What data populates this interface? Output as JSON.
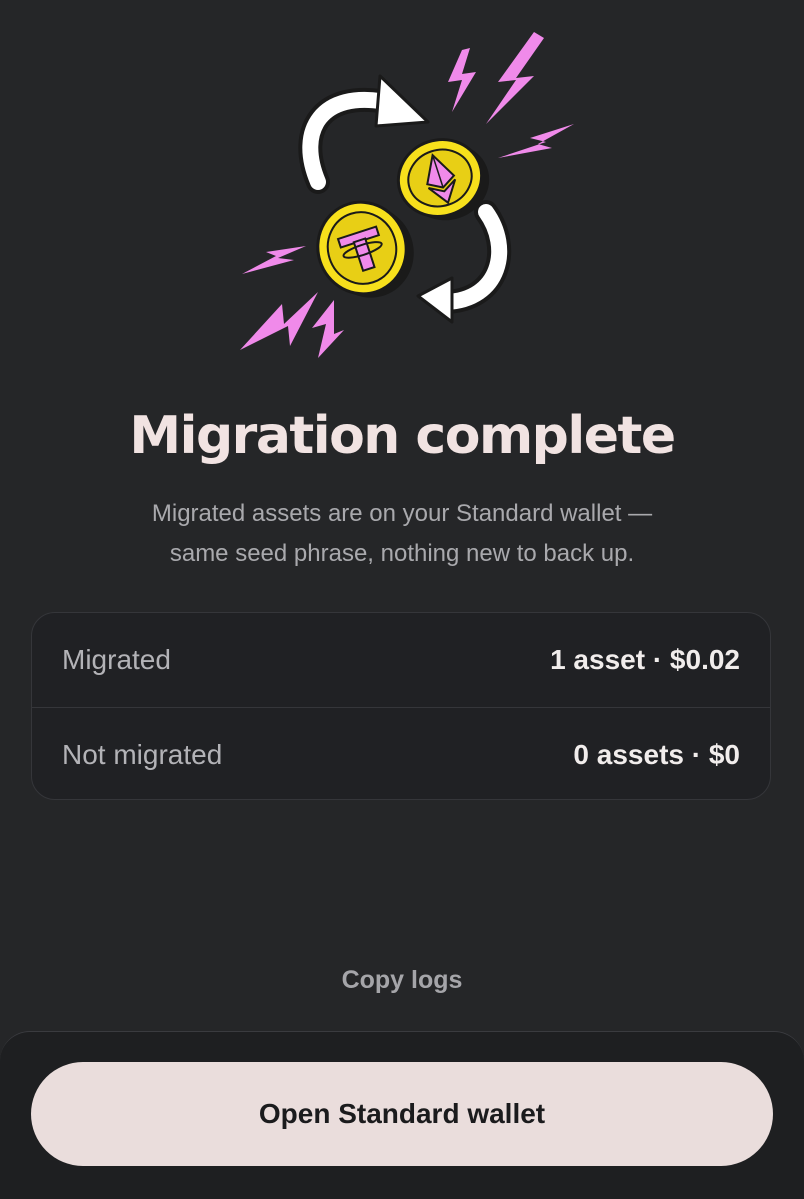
{
  "illustration": {
    "icons": [
      "ethereum-coin-icon",
      "tether-coin-icon",
      "swap-arrows-icon",
      "lightning-bolt-icon"
    ],
    "colors": {
      "coin": "#F7E01C",
      "coin_inner": "#E8CF15",
      "accent": "#F08AEA",
      "arrow": "#FFFFFF"
    }
  },
  "header": {
    "title": "Migration complete",
    "subtitle_line1": "Migrated assets are on your Standard wallet —",
    "subtitle_line2": "same seed phrase, nothing new to back up."
  },
  "summary": {
    "rows": [
      {
        "label": "Migrated",
        "value": "1 asset · $0.02"
      },
      {
        "label": "Not migrated",
        "value": "0 assets · $0"
      }
    ]
  },
  "actions": {
    "copy_logs": "Copy logs",
    "primary": "Open Standard wallet"
  },
  "colors": {
    "background": "#252628",
    "title": "#F1E3E2",
    "button_bg": "#EADDDC"
  }
}
